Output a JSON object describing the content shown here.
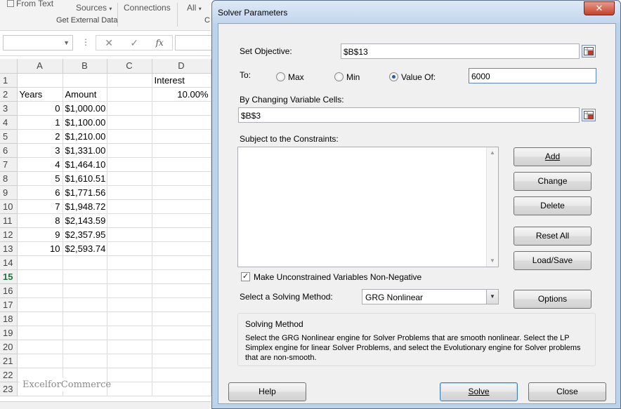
{
  "ribbon": {
    "from_text": "From Text",
    "sources": "Sources",
    "connections": "Connections",
    "all": "All",
    "group_label": "Get External Data",
    "next_group_letter": "C"
  },
  "formula_bar": {
    "fx_label": "fx"
  },
  "sheet": {
    "columns": [
      "A",
      "B",
      "C",
      "D"
    ],
    "rows": [
      {
        "n": "1",
        "a": "",
        "b": "",
        "c": "",
        "d": "Interest"
      },
      {
        "n": "2",
        "a": "Years",
        "b": "Amount",
        "c": "",
        "d": "10.00%"
      },
      {
        "n": "3",
        "a": "0",
        "b": "$1,000.00",
        "c": "",
        "d": ""
      },
      {
        "n": "4",
        "a": "1",
        "b": "$1,100.00",
        "c": "",
        "d": ""
      },
      {
        "n": "5",
        "a": "2",
        "b": "$1,210.00",
        "c": "",
        "d": ""
      },
      {
        "n": "6",
        "a": "3",
        "b": "$1,331.00",
        "c": "",
        "d": ""
      },
      {
        "n": "7",
        "a": "4",
        "b": "$1,464.10",
        "c": "",
        "d": ""
      },
      {
        "n": "8",
        "a": "5",
        "b": "$1,610.51",
        "c": "",
        "d": ""
      },
      {
        "n": "9",
        "a": "6",
        "b": "$1,771.56",
        "c": "",
        "d": ""
      },
      {
        "n": "10",
        "a": "7",
        "b": "$1,948.72",
        "c": "",
        "d": ""
      },
      {
        "n": "11",
        "a": "8",
        "b": "$2,143.59",
        "c": "",
        "d": ""
      },
      {
        "n": "12",
        "a": "9",
        "b": "$2,357.95",
        "c": "",
        "d": ""
      },
      {
        "n": "13",
        "a": "10",
        "b": "$2,593.74",
        "c": "",
        "d": ""
      },
      {
        "n": "14",
        "a": "",
        "b": "",
        "c": "",
        "d": ""
      },
      {
        "n": "15",
        "a": "",
        "b": "",
        "c": "",
        "d": ""
      },
      {
        "n": "16",
        "a": "",
        "b": "",
        "c": "",
        "d": ""
      },
      {
        "n": "17",
        "a": "",
        "b": "",
        "c": "",
        "d": ""
      },
      {
        "n": "18",
        "a": "",
        "b": "",
        "c": "",
        "d": ""
      },
      {
        "n": "19",
        "a": "",
        "b": "",
        "c": "",
        "d": ""
      },
      {
        "n": "20",
        "a": "",
        "b": "",
        "c": "",
        "d": ""
      },
      {
        "n": "21",
        "a": "",
        "b": "",
        "c": "",
        "d": ""
      },
      {
        "n": "22",
        "a": "",
        "b": "",
        "c": "",
        "d": ""
      },
      {
        "n": "23",
        "a": "",
        "b": "",
        "c": "",
        "d": ""
      }
    ],
    "active_row": "15",
    "watermark": "ExcelforCommerce"
  },
  "dialog": {
    "title": "Solver Parameters",
    "close_glyph": "✕",
    "set_objective_label": "Set Objective:",
    "objective_value": "$B$13",
    "to_label": "To:",
    "radio_max": "Max",
    "radio_min": "Min",
    "radio_value_of": "Value Of:",
    "selected_radio": "Value Of:",
    "value_of": "6000",
    "changing_cells_label": "By Changing Variable Cells:",
    "changing_cells_value": "$B$3",
    "constraints_label": "Subject to the Constraints:",
    "buttons": {
      "add": "Add",
      "change": "Change",
      "delete": "Delete",
      "reset_all": "Reset All",
      "load_save": "Load/Save",
      "options": "Options",
      "help": "Help",
      "solve": "Solve",
      "close": "Close"
    },
    "non_negative_label": "Make Unconstrained Variables Non-Negative",
    "non_negative_checked": true,
    "solving_method_label": "Select a Solving Method:",
    "solving_method_value": "GRG Nonlinear",
    "solving_method_group_title": "Solving Method",
    "solving_method_description": "Select the GRG Nonlinear engine for Solver Problems that are smooth nonlinear. Select the LP Simplex engine for linear Solver Problems, and select the Evolutionary engine for Solver problems that are non-smooth."
  }
}
